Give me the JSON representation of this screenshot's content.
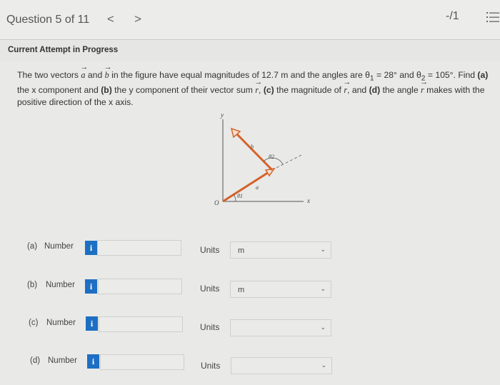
{
  "header": {
    "question_label": "Question 5 of 11",
    "prev_icon": "chevron-left-icon",
    "next_icon": "chevron-right-icon",
    "prev_glyph": "<",
    "next_glyph": ">",
    "score": "-/1",
    "menu_icon": "list-icon"
  },
  "attempt_status": "Current Attempt in Progress",
  "question": {
    "p1": "The two vectors ",
    "vec_a": "a",
    "p2": " and ",
    "vec_b": "b",
    "p3": " in the figure have equal magnitudes of 12.7 m and the angles are θ",
    "sub1": "1",
    "p4": " = 28° and θ",
    "sub2": "2",
    "p5": " = 105°. Find ",
    "bold_a": "(a)",
    "p6": " the x component and ",
    "bold_b": "(b)",
    "p7": " the y component of their vector sum ",
    "vec_r1": "r",
    "p8": ", ",
    "bold_c": "(c)",
    "p9": " the magnitude of ",
    "vec_r2": "r",
    "p10": ", and ",
    "bold_d": "(d)",
    "p11": " the angle ",
    "vec_r3": "r",
    "p12": " makes with the positive direction of the x axis."
  },
  "figure": {
    "y_label": "y",
    "x_label": "x",
    "origin_label": "O",
    "vector_a_label": "a",
    "vector_b_label": "b",
    "theta1_label": "θ1",
    "theta2_label": "θ2",
    "vector_color": "#d4622a"
  },
  "answers": [
    {
      "part": "(a)",
      "label": "Number",
      "value": "",
      "units_label": "Units",
      "unit": "m"
    },
    {
      "part": "(b)",
      "label": "Number",
      "value": "",
      "units_label": "Units",
      "unit": "m"
    },
    {
      "part": "(c)",
      "label": "Number",
      "value": "",
      "units_label": "Units",
      "unit": ""
    },
    {
      "part": "(d)",
      "label": "Number",
      "value": "",
      "units_label": "Units",
      "unit": ""
    }
  ],
  "info_glyph": "i",
  "chevron_glyph": "⌄",
  "colors": {
    "info_button": "#1d6fc4",
    "background": "#e9e9e7"
  }
}
